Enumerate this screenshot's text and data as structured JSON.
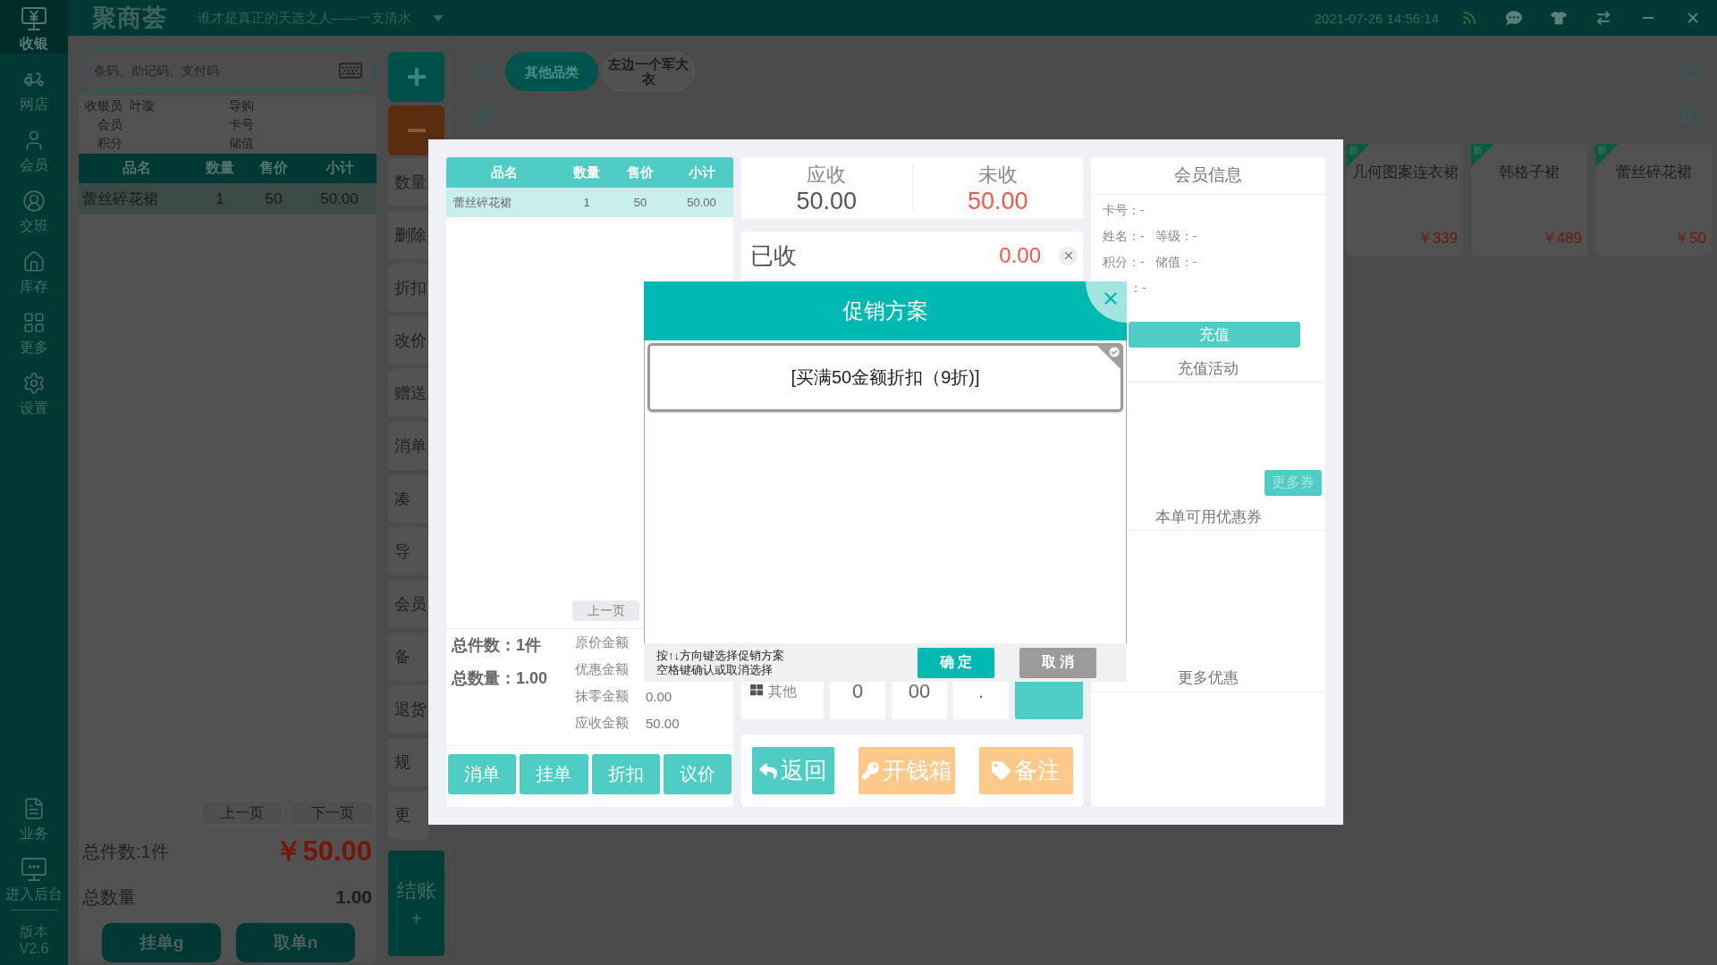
{
  "topbar": {
    "logo": "聚商荟",
    "slogan": "谁才是真正的天选之人——一支清水",
    "datetime": "2021-07-26 14:56:14"
  },
  "sidebar": {
    "items": [
      {
        "label": "收银",
        "selected": true
      },
      {
        "label": "网店",
        "selected": false
      },
      {
        "label": "会员",
        "selected": false
      },
      {
        "label": "交班",
        "selected": false
      },
      {
        "label": "库存",
        "selected": false
      },
      {
        "label": "更多",
        "selected": false
      },
      {
        "label": "设置",
        "selected": false
      }
    ],
    "bottom_items": [
      "业务",
      "进入后台"
    ],
    "version_label": "版本",
    "version": "V2.6"
  },
  "search": {
    "placeholder": "条码、助记码、支付码"
  },
  "cashier_info": [
    {
      "label": "收银员",
      "value": "叶璇"
    },
    {
      "label": "导购"
    },
    {
      "label": "会员"
    },
    {
      "label": "卡号"
    },
    {
      "label": "积分"
    },
    {
      "label": "储值"
    }
  ],
  "cart": {
    "columns": [
      "品名",
      "数量",
      "售价",
      "小计"
    ],
    "rows": [
      {
        "cells": [
          "蕾丝碎花裙",
          "1",
          "50",
          "50.00"
        ],
        "selected": true
      }
    ]
  },
  "pager": [
    "上一页",
    "下一页"
  ],
  "totals": {
    "count": "总件数:1件",
    "amount": "￥50.00",
    "quantity_label": "总数量",
    "quantity": "1.00"
  },
  "order_buttons": [
    "挂单g",
    "取单n"
  ],
  "quick_actions": [
    "数量",
    "删除",
    "折扣",
    "改价",
    "赠送",
    "消单",
    "凑",
    "导",
    "会员",
    "备",
    "退货",
    "规",
    "更"
  ],
  "checkout": {
    "label": "结账",
    "hint": "+"
  },
  "categories": [
    {
      "label": "其他品类",
      "selected": true
    },
    {
      "label": "左边一个军大衣",
      "selected": false
    }
  ],
  "products": [
    {
      "name": "几何图案连衣裙",
      "price": "￥339",
      "badge": "新"
    },
    {
      "name": "韩格子裙",
      "price": "￥489",
      "badge": "新"
    },
    {
      "name": "蕾丝碎花裙",
      "price": "￥50",
      "badge": "新"
    }
  ],
  "payment": {
    "cart": {
      "columns": [
        "品名",
        "数量",
        "售价",
        "小计"
      ],
      "rows": [
        {
          "cells": [
            "蕾丝碎花裙",
            "1",
            "50",
            "50.00"
          ],
          "selected": true
        }
      ],
      "pager": "上一页"
    },
    "summary": {
      "count": "总件数：1件",
      "quantity": "总数量：1.00",
      "amounts": [
        {
          "label": "原价金额"
        },
        {
          "label": "优惠金额"
        },
        {
          "label": "抹零金额",
          "value": "0.00"
        },
        {
          "label": "应收金额",
          "value": "50.00"
        }
      ]
    },
    "actions": [
      "消单",
      "挂单",
      "折扣",
      "议价"
    ],
    "balances": [
      {
        "label": "应收",
        "value": "50.00",
        "kind": "due"
      },
      {
        "label": "未收",
        "value": "50.00",
        "kind": "unpaid"
      }
    ],
    "received": {
      "label": "已收",
      "value": "0.00"
    },
    "keypad": [
      {
        "kind": "other",
        "label": "其他"
      },
      {
        "kind": "key",
        "label": "0"
      },
      {
        "kind": "key",
        "label": "00"
      },
      {
        "kind": "key",
        "label": "."
      },
      {
        "kind": "accent"
      }
    ],
    "footer_buttons": [
      {
        "kind": "primary",
        "label": "返回"
      },
      {
        "kind": "cash",
        "label": "开钱箱"
      },
      {
        "kind": "note",
        "label": "备注"
      }
    ],
    "member": {
      "title": "会员信息",
      "fields": [
        [
          "卡号：-"
        ],
        [
          "姓名：-",
          "等级：-"
        ],
        [
          "积分：-",
          "储值：-"
        ]
      ],
      "field_fragment": "：-",
      "recharge": "充值",
      "sections": [
        "充值活动",
        "本单可用优惠券",
        "更多优惠"
      ],
      "more_coupons": "更多券"
    }
  },
  "promotion_dialog": {
    "title": "促销方案",
    "items": [
      {
        "label": "[买满50金额折扣（9折)]",
        "selected": false
      }
    ],
    "hints": [
      "按↑↓方向键选择促销方案",
      "空格键确认或取消选择"
    ],
    "buttons": [
      {
        "kind": "confirm",
        "label": "确 定"
      },
      {
        "kind": "cancel",
        "label": "取 消"
      }
    ]
  }
}
